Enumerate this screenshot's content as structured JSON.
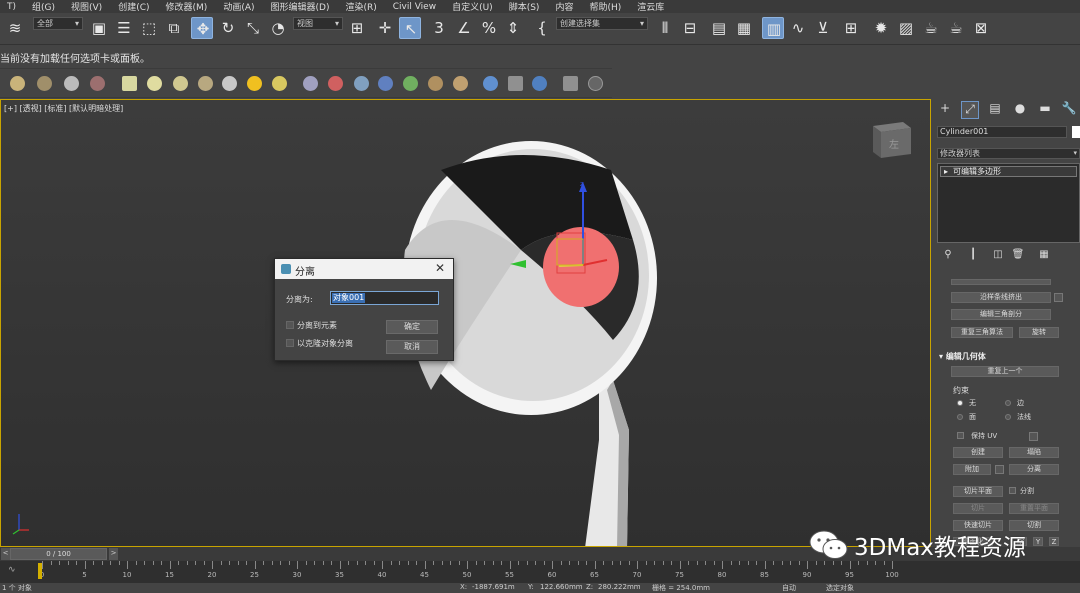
{
  "menubar": {
    "items": [
      "T)",
      "组(G)",
      "视图(V)",
      "创建(C)",
      "修改器(M)",
      "动画(A)",
      "图形编辑器(D)",
      "渲染(R)",
      "Civil View",
      "自定义(U)",
      "脚本(S)",
      "内容",
      "帮助(H)",
      "渲云库"
    ]
  },
  "toolbar": {
    "selection_filter": "全部",
    "reference_coord": "视图",
    "named_selection": "创建选择集"
  },
  "infobar": {
    "message": "当前没有加载任何选项卡或面板。"
  },
  "viewport": {
    "label": "[+] [透视] [标准] [默认明暗处理]",
    "viewcube_label": "左",
    "axis_labels": [
      "z",
      "x",
      "y"
    ]
  },
  "dialog": {
    "title": "分离",
    "detach_as_label": "分离为:",
    "detach_as_value": "对象001",
    "option_element": "分离到元素",
    "option_clone": "以克隆对象分离",
    "ok_label": "确定",
    "cancel_label": "取消"
  },
  "command_panel": {
    "object_name": "Cylinder001",
    "modifier_list": "修改器列表",
    "stack_item": "可编辑多边形",
    "buttons": {
      "extrude_along_spline": "沿样条线挤出",
      "edit_triangulation": "编辑三角剖分",
      "retriangulate": "重复三角算法",
      "turn": "旋转",
      "repeat_last": "重复上一个",
      "create": "创建",
      "collapse": "塌陷",
      "attach": "附加",
      "detach": "分离",
      "slice_plane": "切片平面",
      "split": "分割",
      "slice": "切片",
      "reset_plane": "重置平面",
      "quickslice": "快速切片",
      "cut": "切割",
      "planar": "平面化",
      "x": "X",
      "y": "Y",
      "z": "Z"
    },
    "section_edit_geometry": "编辑几何体",
    "constraints_label": "约束",
    "constraint_none": "无",
    "constraint_edge": "边",
    "constraint_face": "面",
    "constraint_normal": "法线",
    "preserve_uv": "保持 UV"
  },
  "timeline": {
    "slider_text": "0 / 100",
    "ticks": [
      0,
      5,
      10,
      15,
      20,
      25,
      30,
      35,
      40,
      45,
      50,
      55,
      60,
      65,
      70,
      75,
      80,
      85,
      90,
      95,
      100
    ],
    "current_frame": 0
  },
  "statusbar": {
    "selection": "1 个 对象",
    "x_label": "X:",
    "x_value": "-1887.691m",
    "y_label": "Y:",
    "y_value": "122.660mm",
    "z_label": "Z:",
    "z_value": "280.222mm",
    "grid": "栅格 = 254.0mm",
    "autokey": "自动",
    "set_key": "选定对象"
  },
  "watermark": {
    "text": "3DMax教程资源"
  },
  "colors": {
    "accent_active": "#6e96c8",
    "selection_red": "#f07070",
    "viewport_border": "#c8a400"
  }
}
